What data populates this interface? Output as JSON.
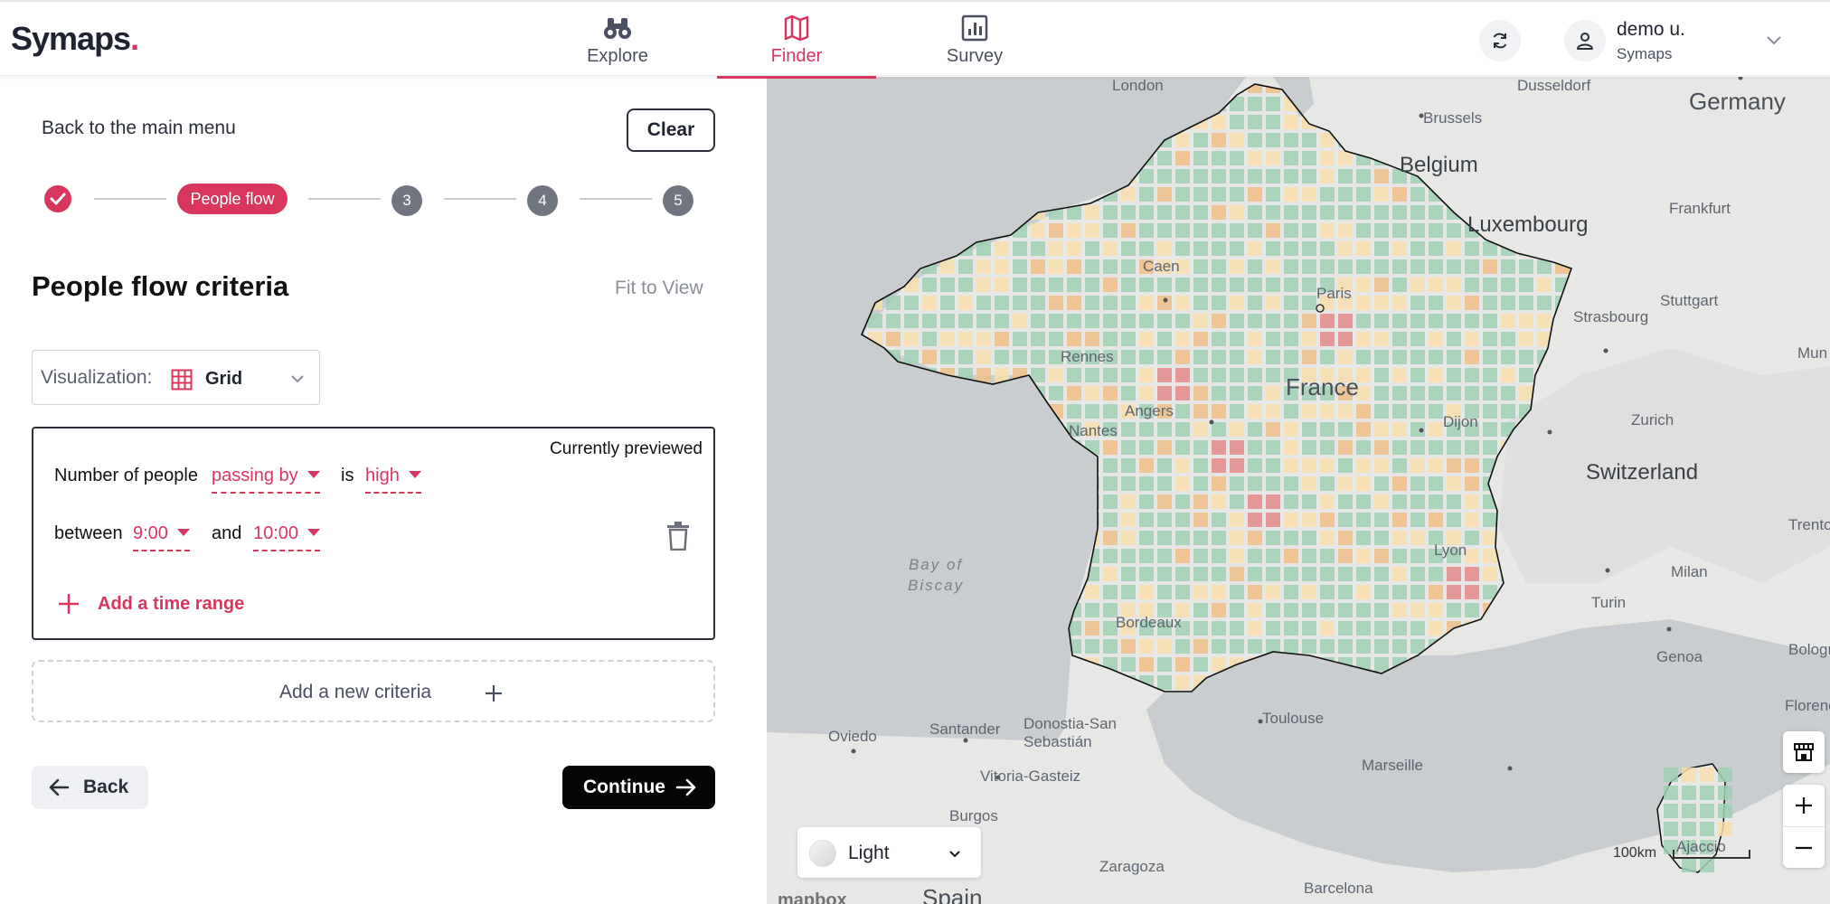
{
  "app": {
    "logo": "Symaps",
    "logo_dot": "."
  },
  "nav": {
    "tabs": [
      {
        "label": "Explore",
        "icon": "binoculars-icon"
      },
      {
        "label": "Finder",
        "icon": "map-icon",
        "active": true
      },
      {
        "label": "Survey",
        "icon": "bar-chart-icon"
      }
    ]
  },
  "user": {
    "name": "demo u.",
    "org": "Symaps"
  },
  "panel": {
    "back_main_label": "Back to the main menu",
    "clear_label": "Clear",
    "stepper": {
      "current_label": "People flow",
      "steps": [
        "3",
        "4",
        "5"
      ]
    },
    "title": "People flow criteria",
    "fit_to_view": "Fit to View",
    "visualization": {
      "label": "Visualization:",
      "value": "Grid"
    },
    "criteria": {
      "previewed": "Currently previewed",
      "sentence_start": "Number of people",
      "flow_type": "passing by",
      "is_word": "is",
      "level": "high",
      "between_word": "between",
      "from_time": "9:00",
      "and_word": "and",
      "to_time": "10:00",
      "add_time_range": "Add a time range"
    },
    "add_new_criteria": "Add a new criteria",
    "back_label": "Back",
    "continue_label": "Continue"
  },
  "map": {
    "labels": {
      "london": "London",
      "dusseldorf": "Dusseldorf",
      "germany": "Germany",
      "brussels": "Brussels",
      "belgium": "Belgium",
      "frankfurt": "Frankfurt",
      "luxembourg": "Luxembourg",
      "stuttgart": "Stuttgart",
      "mun": "Mun",
      "caen": "Caen",
      "paris": "Paris",
      "strasbourg": "Strasbourg",
      "rennes": "Rennes",
      "france": "France",
      "zurich": "Zurich",
      "angers": "Angers",
      "dijon": "Dijon",
      "nantes": "Nantes",
      "switzerland": "Switzerland",
      "trento": "Trento",
      "bay_of_biscay": "Bay of\nBiscay",
      "lyon": "Lyon",
      "milan": "Milan",
      "turin": "Turin",
      "bordeaux": "Bordeaux",
      "genoa": "Genoa",
      "bologna": "Bologn",
      "santander": "Santander",
      "donostia": "Donostia-San\nSebastián",
      "oviedo": "Oviedo",
      "toulouse": "Toulouse",
      "florence": "Florenc",
      "vitoria": "Vitoria-Gasteiz",
      "marseille": "Marseille",
      "burgos": "Burgos",
      "ajaccio": "Ajaccio",
      "zaragoza": "Zaragoza",
      "barcelona": "Barcelona",
      "spain": "Spain"
    },
    "style": "Light",
    "scale": "100km",
    "attribution": "mapbox",
    "colors": {
      "low": "#9fd0b4",
      "medium": "#f6deaa",
      "elevated": "#efbf87",
      "high": "#e38a8a"
    }
  }
}
